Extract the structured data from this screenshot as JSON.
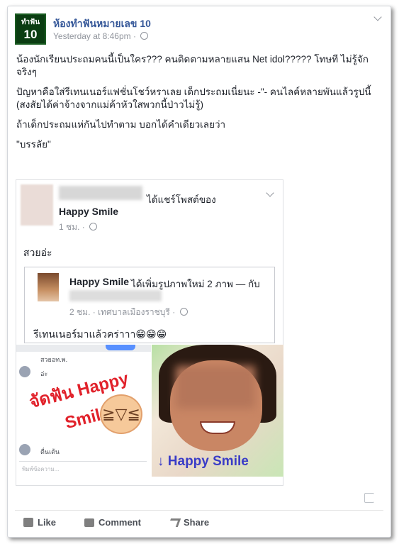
{
  "post": {
    "page_logo_line1": "ทำฟัน",
    "page_logo_line2": "10",
    "page_name": "ห้องทำฟันหมายเลข 10",
    "timestamp": "Yesterday at 8:46pm",
    "meta_sep": " · ",
    "privacy_icon": "globe-icon",
    "paragraphs": [
      "น้องนักเรียนประถมคนนี้เป็นใคร??? คนติดตามหลายแสน Net idol????? โทษที ไม่รู้จักจริงๆ",
      "ปัญหาคือใส่รีเทนเนอร์แฟชั่นโชว์หราเลย เด็กประถมเนี่ยนะ -\"- คนไลค์หลายพันแล้วรูปนี้",
      "(สงสัยได้ค่าจ้างจากแม่ค้าหัวใสพวกนี้ป่าวไม่รู้)",
      "ถ้าเด็กประถมแห่กันไปทำตาม บอกได้คำเดียวเลยว่า",
      "\"บรรลัย\""
    ]
  },
  "shared_post": {
    "shared_label": "ได้แชร์โพสต์ของ",
    "target_name": "Happy Smile",
    "meta": "1 ชม. · ",
    "text": "สวยอ่ะ",
    "inner": {
      "name": "Happy Smile",
      "added_label": "ได้เพิ่มรูปภาพใหม่ 2 ภาพ — กับ",
      "meta": "2 ชม. · เทศบาลเมืองราชบุรี · ",
      "text": "รีเทนเนอร์มาแล้วคร่าาา😁😁😁"
    },
    "photo_left": {
      "chat_line1": "สวยอท.พ.",
      "chat_line2": "อ่ะ",
      "brand_line1": "จัดฟัน Happy",
      "brand_line2": "Smile",
      "chat_line3": "ตื่นเต้น",
      "chat_placeholder": "พิมพ์ข้อความ..."
    },
    "photo_right": {
      "brand": "Happy Smile"
    }
  },
  "actions": {
    "like": "Like",
    "comment": "Comment",
    "share": "Share"
  }
}
